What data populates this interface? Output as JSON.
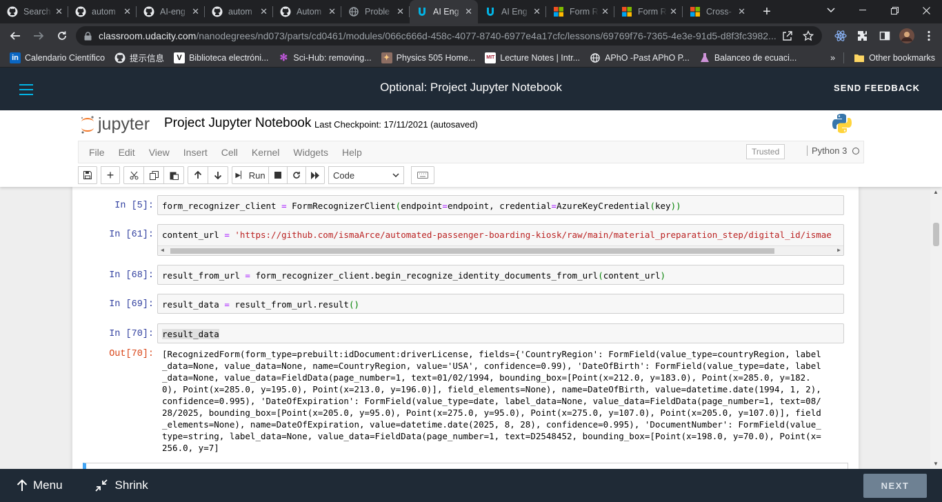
{
  "browser": {
    "tabs": [
      {
        "title": "Search",
        "icon": "github-icon",
        "active": false
      },
      {
        "title": "autom",
        "icon": "github-icon",
        "active": false
      },
      {
        "title": "AI-eng",
        "icon": "github-icon",
        "active": false
      },
      {
        "title": "autom",
        "icon": "github-icon",
        "active": false
      },
      {
        "title": "Autom",
        "icon": "github-icon",
        "active": false
      },
      {
        "title": "Proble",
        "icon": "globe-icon",
        "active": false
      },
      {
        "title": "AI Eng",
        "icon": "udacity-icon",
        "active": true
      },
      {
        "title": "AI Eng",
        "icon": "udacity-icon",
        "active": false
      },
      {
        "title": "Form R",
        "icon": "microsoft-icon",
        "active": false
      },
      {
        "title": "Form R",
        "icon": "microsoft-icon",
        "active": false
      },
      {
        "title": "Cross-",
        "icon": "microsoft-icon",
        "active": false
      }
    ],
    "url_host": "classroom.udacity.com",
    "url_path": "/nanodegrees/nd073/parts/cd0461/modules/066c666d-458c-4077-8740-6977e4a17cfc/lessons/69769f76-7365-4e3e-91d5-d8f3fc3982...",
    "bookmarks": [
      {
        "label": "Calendario Científico",
        "icon": "linkedin-icon"
      },
      {
        "label": "提示信息",
        "icon": "github-icon"
      },
      {
        "label": "Biblioteca electróni...",
        "icon": "v-icon"
      },
      {
        "label": "Sci-Hub: removing...",
        "icon": "scihub-icon"
      },
      {
        "label": "Physics 505 Home...",
        "icon": "physics-icon"
      },
      {
        "label": "Lecture Notes | Intr...",
        "icon": "mit-icon"
      },
      {
        "label": "APhO -Past APhO P...",
        "icon": "globe-icon"
      },
      {
        "label": "Balanceo de ecuaci...",
        "icon": "flask-icon"
      }
    ],
    "overflow": "»",
    "other_bookmarks": "Other bookmarks"
  },
  "udacity": {
    "title": "Optional: Project Jupyter Notebook",
    "feedback": "SEND FEEDBACK",
    "menu": "Menu",
    "shrink": "Shrink",
    "next": "NEXT"
  },
  "jupyter": {
    "logo": "jupyter",
    "notebook_name": "Project Jupyter Notebook",
    "checkpoint": "Last Checkpoint: 17/11/2021  (autosaved)",
    "menu": [
      "File",
      "Edit",
      "View",
      "Insert",
      "Cell",
      "Kernel",
      "Widgets",
      "Help"
    ],
    "trusted": "Trusted",
    "kernel": "Python 3",
    "run": "Run",
    "cell_type": "Code"
  },
  "cells": {
    "c5": {
      "prompt": "In [5]:"
    },
    "c61": {
      "prompt": "In [61]:"
    },
    "c68": {
      "prompt": "In [68]:"
    },
    "c69": {
      "prompt": "In [69]:"
    },
    "c70": {
      "prompt": "In [70]:",
      "code": "result_data"
    },
    "out70": {
      "prompt": "Out[70]:"
    }
  },
  "code_tokens": {
    "c5": [
      "form_recognizer_client ",
      "= ",
      "FormRecognizerClient",
      "(",
      "endpoint",
      "=",
      "endpoint, credential",
      "=",
      "AzureKeyCredential",
      "(",
      "key",
      "))"
    ],
    "c61": [
      "content_url ",
      "= ",
      "'https://github.com/ismaArce/automated-passenger-boarding-kiosk/raw/main/material_preparation_step/digital_id/ismae"
    ],
    "c68": [
      "result_from_url ",
      "= ",
      "form_recognizer_client.begin_recognize_identity_documents_from_url",
      "(",
      "content_url",
      ")"
    ],
    "c69": [
      "result_data ",
      "= ",
      "result_from_url.result",
      "()"
    ]
  },
  "output_lines": [
    "[RecognizedForm(form_type=prebuilt:idDocument:driverLicense, fields={'CountryRegion': FormField(value_type=countryRegion, label",
    "_data=None, value_data=None, name=CountryRegion, value='USA', confidence=0.99), 'DateOfBirth': FormField(value_type=date, label",
    "_data=None, value_data=FieldData(page_number=1, text=01/02/1994, bounding_box=[Point(x=212.0, y=183.0), Point(x=285.0, y=182.",
    "0), Point(x=285.0, y=195.0), Point(x=213.0, y=196.0)], field_elements=None), name=DateOfBirth, value=datetime.date(1994, 1, 2),",
    "confidence=0.995), 'DateOfExpiration': FormField(value_type=date, label_data=None, value_data=FieldData(page_number=1, text=08/",
    "28/2025, bounding_box=[Point(x=205.0, y=95.0), Point(x=275.0, y=95.0), Point(x=275.0, y=107.0), Point(x=205.0, y=107.0)], field",
    "_elements=None), name=DateOfExpiration, value=datetime.date(2025, 8, 28), confidence=0.995), 'DocumentNumber': FormField(value_",
    "type=string, label_data=None, value_data=FieldData(page_number=1, text=D2548452, bounding_box=[Point(x=198.0, y=70.0), Point(x=",
    "256.0, y=7]"
  ]
}
